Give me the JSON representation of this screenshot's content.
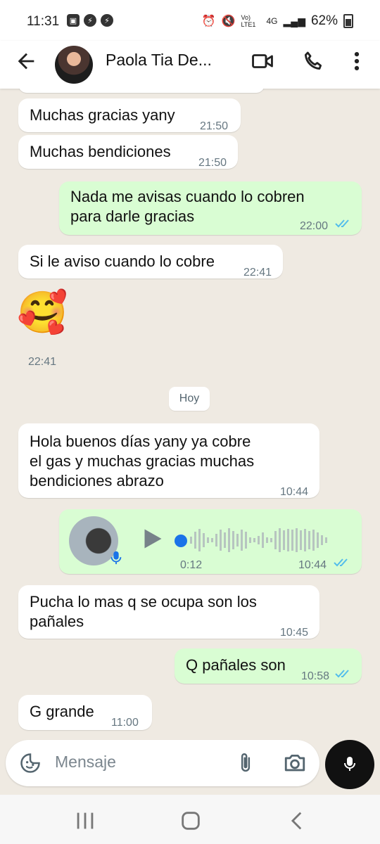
{
  "status_bar": {
    "time": "11:31",
    "battery": "62%",
    "network": "4G",
    "volte_lte": "Vo) LTE1"
  },
  "header": {
    "contact_name": "Paola Tia De...",
    "icons": [
      "back-arrow-icon",
      "video-call-icon",
      "phone-icon",
      "more-vert-icon"
    ]
  },
  "messages": [
    {
      "direction": "in",
      "text": "Muchas gracias yany",
      "time": "21:50"
    },
    {
      "direction": "in",
      "text": "Muchas bendiciones",
      "time": "21:50"
    },
    {
      "direction": "out",
      "text_lines": [
        "Nada me avisas cuando lo cobren",
        "para darle gracias"
      ],
      "time": "22:00",
      "status": "read"
    },
    {
      "direction": "in",
      "text": "Si le aviso cuando lo cobre",
      "time": "22:41"
    },
    {
      "direction": "in",
      "type": "emoji",
      "emoji": "🥰",
      "time": "22:41"
    },
    {
      "direction": "in",
      "text_lines": [
        "Hola buenos días yany ya cobre",
        "el gas y muchas gracias muchas",
        "bendiciones abrazo"
      ],
      "time": "10:44"
    },
    {
      "direction": "out",
      "type": "voice",
      "duration": "0:12",
      "time": "10:44",
      "status": "read"
    },
    {
      "direction": "in",
      "text_lines": [
        "Pucha lo mas q se ocupa son los",
        "pañales"
      ],
      "time": "10:45"
    },
    {
      "direction": "out",
      "text": "Q pañales son",
      "time": "10:58",
      "status": "read"
    },
    {
      "direction": "in",
      "text": "G grande",
      "time": "11:00"
    }
  ],
  "date_divider": "Hoy",
  "composer": {
    "placeholder": "Mensaje"
  },
  "colors": {
    "chat_bg": "#efeae2",
    "outgoing_bubble": "#d9fdd3",
    "incoming_bubble": "#ffffff",
    "read_ticks": "#53bdeb",
    "voice_accent": "#1a73e8"
  }
}
